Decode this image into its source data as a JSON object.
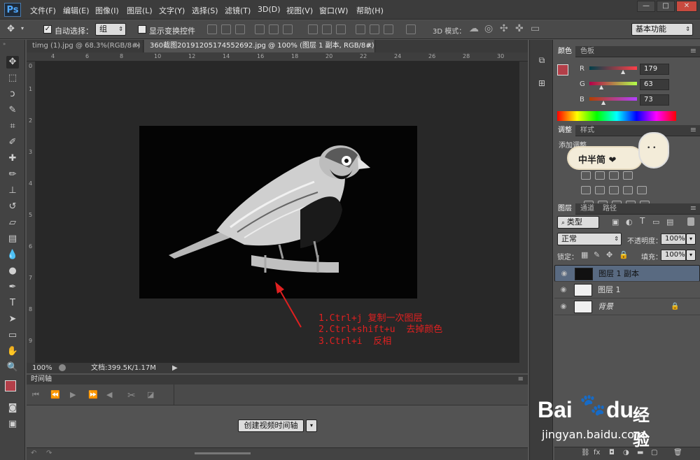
{
  "app": {
    "logo": "Ps"
  },
  "menu": [
    "文件(F)",
    "编辑(E)",
    "图像(I)",
    "图层(L)",
    "文字(Y)",
    "选择(S)",
    "滤镜(T)",
    "3D(D)",
    "视图(V)",
    "窗口(W)",
    "帮助(H)"
  ],
  "window_controls": {
    "minimize": "—",
    "restore": "□",
    "close": "✕"
  },
  "options_bar": {
    "auto_select_label": "自动选择：",
    "auto_select_checked": "✓",
    "auto_select_value": "组",
    "show_transform_label": "显示变换控件",
    "mode_3d_label": "3D 模式：",
    "workspace": "基本功能"
  },
  "tabs": [
    {
      "label": "timg (1).jpg @ 68.3%(RGB/8#) *",
      "close": "×"
    },
    {
      "label": "360截图20191205174552692.jpg @ 100% (图层 1 副本, RGB/8#) *",
      "close": "×"
    }
  ],
  "ruler_h": [
    "4",
    "6",
    "8",
    "10",
    "12",
    "14",
    "16",
    "18",
    "20",
    "22",
    "24",
    "26",
    "28",
    "30"
  ],
  "ruler_v": [
    "0",
    "1",
    "2",
    "3",
    "4",
    "5",
    "6",
    "7",
    "8",
    "9"
  ],
  "status": {
    "zoom": "100%",
    "doc": "文档:399.5K/1.17M"
  },
  "annotation": {
    "step1": "1.Ctrl+j 复制一次图层",
    "step2": "2.Ctrl+shift+u  去掉颜色",
    "step3": "3.Ctrl+i  反相"
  },
  "timeline": {
    "title": "时间轴",
    "create_button": "创建视频时间轴"
  },
  "color_panel": {
    "tabs": [
      "颜色",
      "色板"
    ],
    "r_label": "R",
    "r": "179",
    "g_label": "G",
    "g": "63",
    "b_label": "B",
    "b": "73",
    "foreground": "#b33f49"
  },
  "adjust_panel": {
    "tabs": [
      "调整",
      "样式"
    ],
    "add_label": "添加调整",
    "sticker_text": "中半简 ❤"
  },
  "layers_panel": {
    "tabs": [
      "图层",
      "通道",
      "路径"
    ],
    "filter_kind": "类型",
    "blend_mode": "正常",
    "opacity_label": "不透明度：",
    "opacity": "100%",
    "lock_label": "锁定：",
    "fill_label": "填充：",
    "fill": "100%",
    "layers": [
      {
        "name": "图层 1 副本",
        "selected": true
      },
      {
        "name": "图层 1",
        "selected": false
      },
      {
        "name": "背景",
        "selected": false,
        "locked": true
      }
    ]
  },
  "watermark": {
    "brand_left": "Bai",
    "brand_right": "du",
    "brand_cn": "经验",
    "url": "jingyan.baidu.com"
  },
  "colors": {
    "accent_red": "#e02020",
    "selected_layer": "#596a81",
    "ps_blue": "#4fa8ff"
  }
}
